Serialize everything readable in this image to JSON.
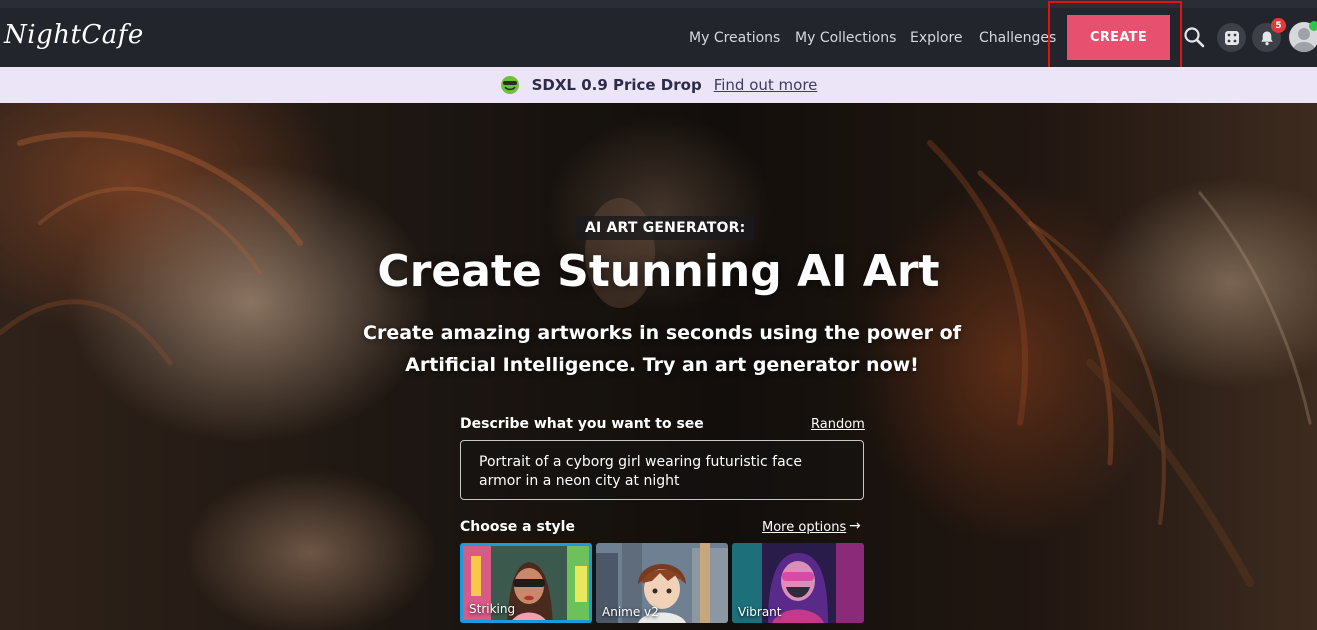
{
  "brand": {
    "logo_text": "NightCafe"
  },
  "nav": {
    "links": [
      "My Creations",
      "My Collections",
      "Explore",
      "Challenges"
    ],
    "create_label": "CREATE",
    "notification_count": "5"
  },
  "banner": {
    "icon": "smiling-face-emoji-icon",
    "title": "SDXL 0.9 Price Drop",
    "link_label": "Find out more"
  },
  "hero": {
    "eyebrow": "AI ART GENERATOR:",
    "title": "Create Stunning AI Art",
    "subtitle": "Create amazing artworks in seconds using the power of Artificial Intelligence. Try an art generator now!"
  },
  "prompt": {
    "label": "Describe what you want to see",
    "random_label": "Random",
    "value": "Portrait of a cyborg girl wearing futuristic face armor in a neon city at night"
  },
  "styles": {
    "label": "Choose a style",
    "more_label": "More options",
    "items": [
      {
        "name": "Striking",
        "selected": true
      },
      {
        "name": "Anime v2",
        "selected": false
      },
      {
        "name": "Vibrant",
        "selected": false
      }
    ]
  },
  "colors": {
    "accent": "#e8506f",
    "navbar": "#22252c",
    "banner": "#ebe5f7",
    "selected_border": "#1a9be0"
  }
}
